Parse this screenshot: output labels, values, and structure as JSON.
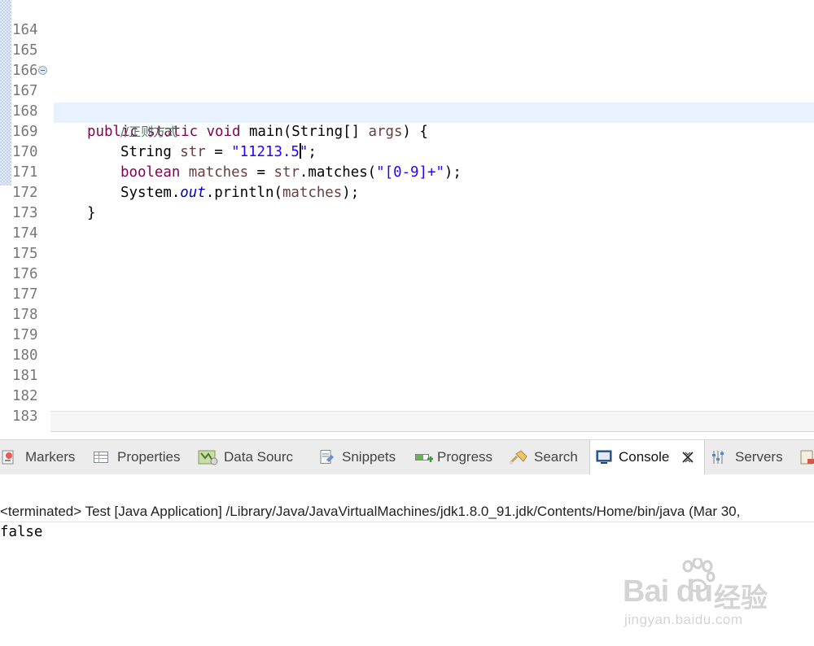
{
  "editor": {
    "lines": [
      {
        "num": "164"
      },
      {
        "num": "165"
      },
      {
        "num": "166"
      },
      {
        "num": "167",
        "kw1": "public static void",
        "plain1": " main(String[] ",
        "var1": "args",
        "plain2": ") {"
      },
      {
        "num": "168",
        "comment": "//正则方式"
      },
      {
        "num": "169",
        "plain1": "String ",
        "var1": "str",
        "plain2": " = ",
        "str1": "\"11213.5",
        "str2": "\"",
        "plain3": ";"
      },
      {
        "num": "170",
        "kw1": "boolean",
        "plain1": " ",
        "var1": "matches",
        "plain2": " = ",
        "var2": "str",
        "plain3": ".matches(",
        "str1": "\"[0-9]+\"",
        "plain4": ");"
      },
      {
        "num": "171",
        "plain1": "System.",
        "fld1": "out",
        "plain2": ".println(",
        "var1": "matches",
        "plain3": ");"
      },
      {
        "num": "172",
        "plain1": "}"
      },
      {
        "num": "173"
      },
      {
        "num": "174"
      },
      {
        "num": "175"
      },
      {
        "num": "176"
      },
      {
        "num": "177"
      },
      {
        "num": "178"
      },
      {
        "num": "179"
      },
      {
        "num": "180"
      },
      {
        "num": "181"
      },
      {
        "num": "182"
      },
      {
        "num": "183"
      }
    ]
  },
  "views": {
    "tabs": [
      {
        "label": "Markers",
        "icon": "markers-icon"
      },
      {
        "label": "Properties",
        "icon": "properties-icon"
      },
      {
        "label": "Data Sourc",
        "icon": "data-source-icon"
      },
      {
        "label": "Snippets",
        "icon": "snippets-icon"
      },
      {
        "label": "Progress",
        "icon": "progress-icon"
      },
      {
        "label": "Search",
        "icon": "search-icon"
      },
      {
        "label": "Console",
        "icon": "console-icon",
        "active": true
      },
      {
        "label": "Servers",
        "icon": "servers-icon"
      }
    ]
  },
  "console": {
    "header": "<terminated> Test [Java Application] /Library/Java/JavaVirtualMachines/jdk1.8.0_91.jdk/Contents/Home/bin/java (Mar 30,",
    "output": "false"
  },
  "watermark": {
    "logo": "Bai du",
    "cn": "经验",
    "url": "jingyan.baidu.com"
  }
}
